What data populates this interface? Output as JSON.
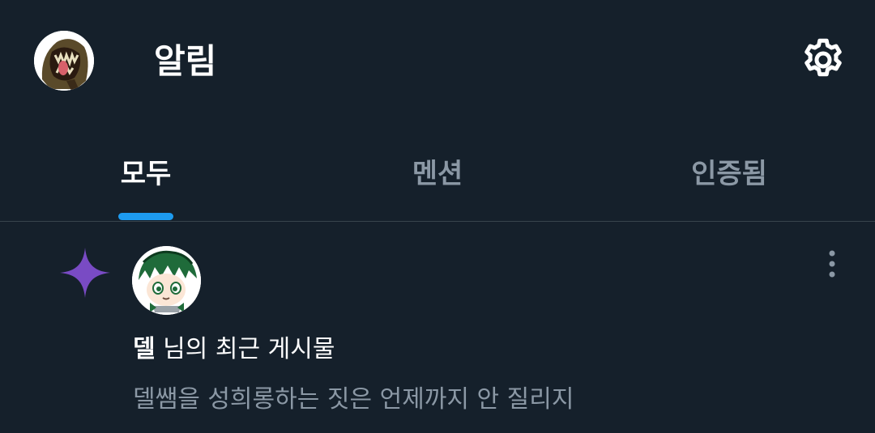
{
  "header": {
    "title": "알림",
    "avatar_icon": "profile-avatar",
    "settings_icon": "gear-icon"
  },
  "tabs": [
    {
      "label": "모두",
      "active": true
    },
    {
      "label": "멘션",
      "active": false
    },
    {
      "label": "인증됨",
      "active": false
    }
  ],
  "colors": {
    "background": "#15202b",
    "accent": "#1d9bf0",
    "sparkle": "#794bc4",
    "muted": "#8b98a5",
    "divider": "#38444d"
  },
  "notification": {
    "icon": "sparkle-icon",
    "user": "델",
    "text": " 님의 최근 게시물",
    "preview": "델쌤을 성희롱하는 짓은 언제까지 안 질리지",
    "more_icon": "more-vertical-icon"
  }
}
